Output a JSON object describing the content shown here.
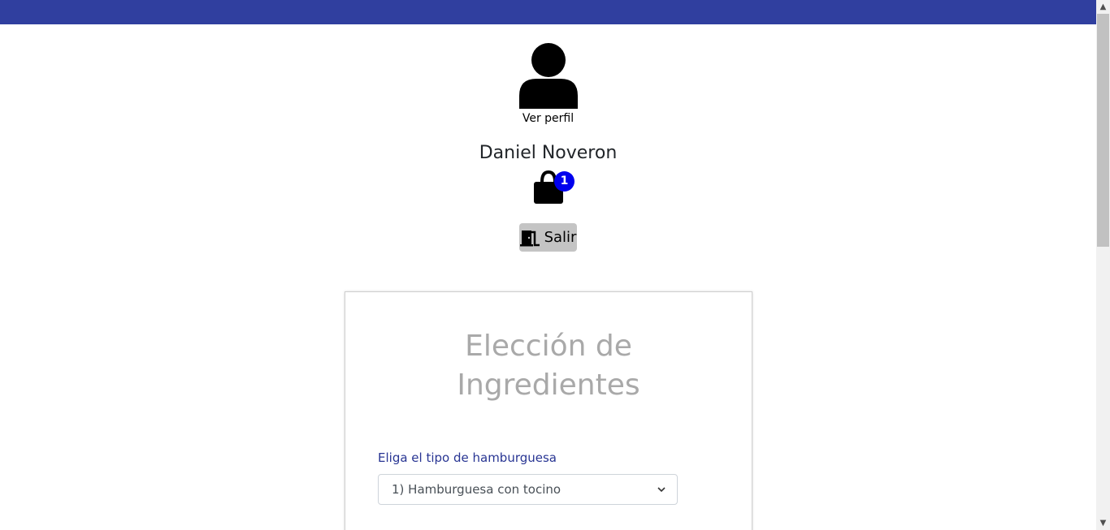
{
  "header": {
    "bar_color": "#303f9f"
  },
  "profile": {
    "icon": "user-icon",
    "view_profile_label": "Ver perfil",
    "user_name": "Daniel Noveron"
  },
  "cart": {
    "icon": "shopping-bag-icon",
    "count": "1",
    "badge_color": "#0000ee"
  },
  "logout": {
    "icon": "door-exit-icon",
    "label": "Salir"
  },
  "card": {
    "title_line1": "Elección de",
    "title_line2": "Ingredientes",
    "burger_type_label": "Eliga el tipo de hamburguesa",
    "burger_type_selected": "1) Hamburguesa con tocino"
  }
}
